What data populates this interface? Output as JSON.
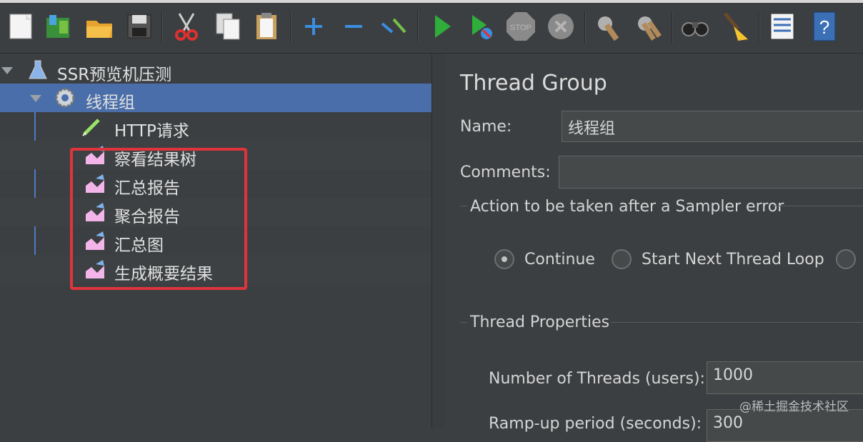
{
  "toolbar": {
    "icons": [
      "new-icon",
      "templates-icon",
      "open-icon",
      "save-icon",
      "cut-icon",
      "copy-icon",
      "paste-icon",
      "expand-icon",
      "collapse-icon",
      "toggle-icon",
      "start-icon",
      "start-no-pause-icon",
      "stop-icon",
      "shutdown-icon",
      "clear-icon",
      "clear-all-icon",
      "search-icon",
      "reset-search-icon",
      "function-helper-icon",
      "help-icon"
    ]
  },
  "tree": {
    "root": "SSR预览机压测",
    "thread_group": "线程组",
    "children": [
      "HTTP请求",
      "察看结果树",
      "汇总报告",
      "聚合报告",
      "汇总图",
      "生成概要结果"
    ]
  },
  "panel": {
    "title": "Thread Group",
    "name_label": "Name:",
    "name_value": "线程组",
    "comments_label": "Comments:",
    "comments_value": "",
    "action_section": "Action to be taken after a Sampler error",
    "radio_continue": "Continue",
    "radio_next_loop": "Start Next Thread Loop",
    "thread_props": "Thread Properties",
    "threads_label": "Number of Threads (users):",
    "threads_value": "1000",
    "rampup_label": "Ramp-up period (seconds):",
    "rampup_value": "300"
  },
  "watermark": "@稀土掘金技术社区",
  "colors": {
    "selection": "#4a6ea9",
    "highlight_box": "#e0343c",
    "run_green": "#2fae3c"
  }
}
